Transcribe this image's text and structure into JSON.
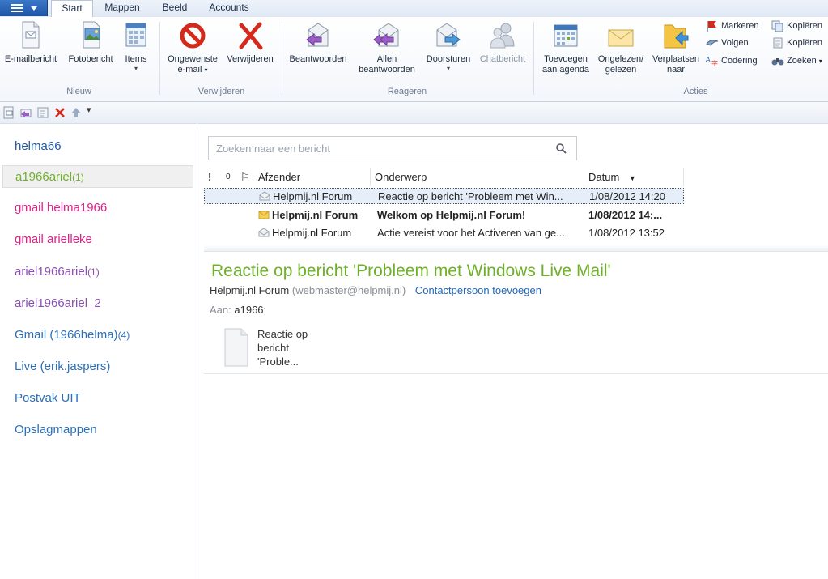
{
  "tabs": [
    "Start",
    "Mappen",
    "Beeld",
    "Accounts"
  ],
  "ribbon": {
    "nieuw": {
      "label": "Nieuw",
      "buttons": [
        "E-mailbericht",
        "Fotobericht",
        "Items"
      ]
    },
    "verwijderen": {
      "label": "Verwijderen",
      "buttons": [
        "Ongewenste",
        "e-mail",
        "Verwijderen"
      ]
    },
    "reageren": {
      "label": "Reageren",
      "buttons": [
        "Beantwoorden",
        "Allen",
        "beantwoorden",
        "Doorsturen",
        "Chatbericht"
      ]
    },
    "acties": {
      "label": "Acties",
      "buttons": [
        "Toevoegen",
        "aan agenda",
        "Ongelezen/",
        "gelezen",
        "Verplaatsen",
        "naar"
      ],
      "small": [
        "Markeren",
        "Volgen",
        "Codering",
        "Kopiëren",
        "Kopiëren",
        "Zoeken"
      ]
    }
  },
  "folders": [
    {
      "name": "helma66",
      "count": "",
      "color": "#1f5aa8"
    },
    {
      "name": "a1966ariel",
      "count": "(1)",
      "color": "#6fb02a"
    },
    {
      "name": "gmail helma1966",
      "count": "",
      "color": "#e0208a"
    },
    {
      "name": "gmail arielleke",
      "count": "",
      "color": "#e0208a"
    },
    {
      "name": "ariel1966ariel",
      "count": "(1)",
      "color": "#8b4fb3"
    },
    {
      "name": "ariel1966ariel_2",
      "count": "",
      "color": "#8b4fb3"
    },
    {
      "name": "Gmail (1966helma)",
      "count": "(4)",
      "color": "#2b6fb8"
    },
    {
      "name": "Live (erik.jaspers)",
      "count": "",
      "color": "#2b6fb8"
    },
    {
      "name": "Postvak UIT",
      "count": "",
      "color": "#2b6fb8"
    },
    {
      "name": "Opslagmappen",
      "count": "",
      "color": "#2b6fb8"
    }
  ],
  "search": {
    "placeholder": "Zoeken naar een bericht"
  },
  "columns": {
    "importance": "!",
    "attachment": "0",
    "flag": "⚐",
    "sender": "Afzender",
    "subject": "Onderwerp",
    "date": "Datum"
  },
  "messages": [
    {
      "sender": "Helpmij.nl Forum",
      "subject": "Reactie op bericht 'Probleem met Win...",
      "date": "1/08/2012 14:20"
    },
    {
      "sender": "Helpmij.nl Forum",
      "subject": "Welkom op Helpmij.nl Forum!",
      "date": "1/08/2012 14:..."
    },
    {
      "sender": "Helpmij.nl Forum",
      "subject": "Actie vereist voor het Activeren van ge...",
      "date": "1/08/2012 13:52"
    }
  ],
  "reading": {
    "subject": "Reactie op bericht 'Probleem met Windows Live Mail'",
    "from_name": "Helpmij.nl Forum",
    "from_email": "(webmaster@helpmij.nl)",
    "add_contact": "Contactpersoon toevoegen",
    "to_label": "Aan:",
    "to_value": "a1966;",
    "attachment_lines": [
      "Reactie op",
      "bericht",
      "'Proble..."
    ]
  },
  "colors": {
    "accent_green": "#6fb02a",
    "link_blue": "#2266bb"
  }
}
